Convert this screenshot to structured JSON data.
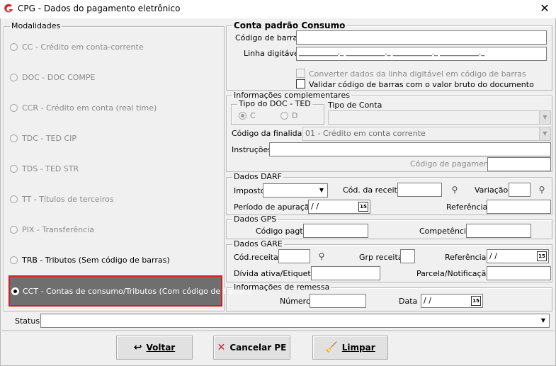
{
  "window": {
    "title": "CPG - Dados do pagamento eletrônico",
    "close_glyph": "✕",
    "logo_icon": "app-logo-icon"
  },
  "modalidades": {
    "legend": "Modalidades",
    "items": [
      {
        "label": "CC - Crédito em conta-corrente",
        "enabled": false,
        "selected": false
      },
      {
        "label": "DOC - DOC COMPE",
        "enabled": false,
        "selected": false
      },
      {
        "label": "CCR - Crédito em conta (real time)",
        "enabled": false,
        "selected": false
      },
      {
        "label": "TDC - TED CIP",
        "enabled": false,
        "selected": false
      },
      {
        "label": "TDS - TED STR",
        "enabled": false,
        "selected": false
      },
      {
        "label": "TT - Títulos de terceiros",
        "enabled": false,
        "selected": false
      },
      {
        "label": "PIX - Transferência",
        "enabled": false,
        "selected": false
      },
      {
        "label": "TRB - Tributos (Sem código de barras)",
        "enabled": true,
        "selected": false
      },
      {
        "label": "CCT - Contas de consumo/Tributos (Com código de barras)",
        "enabled": true,
        "selected": true
      }
    ]
  },
  "conta_padrao": {
    "legend": "Conta padrão Consumo",
    "codigo_barras_label": "Código de barras",
    "codigo_barras_value": "",
    "linha_digitavel_label": "Linha digitável",
    "linha_digitavel_value": "___________._ ___________._ ___________._ ___________._",
    "converter_label": "Converter dados da linha digitável em código de barras",
    "converter_checked": false,
    "validar_label": "Validar código de barras com o valor bruto do documento",
    "validar_checked": false
  },
  "info_complementares": {
    "legend": "Informações complementares",
    "tipo_doc_legend": "Tipo do DOC - TED",
    "option_c": "C",
    "option_d": "D",
    "tipo_conta_label": "Tipo de Conta",
    "tipo_conta_value": "",
    "codigo_finalidade_label": "Código da finalidade",
    "codigo_finalidade_value": "01 - Crédito em conta corrente",
    "instrucoes_label": "Instruções",
    "instrucoes_value": "",
    "codigo_pagamento_label": "Código de pagamento",
    "codigo_pagamento_value": ""
  },
  "darf": {
    "legend": "Dados DARF",
    "imposto_label": "Imposto",
    "imposto_value": "",
    "cod_receita_label": "Cód. da receita",
    "cod_receita_value": "",
    "variacao_label": "Variação",
    "variacao_value": "",
    "periodo_label": "Período de apuração",
    "periodo_value": " / /",
    "referencia_label": "Referência",
    "referencia_value": ""
  },
  "gps": {
    "legend": "Dados GPS",
    "codigo_pagto_label": "Código pagto",
    "codigo_pagto_value": "",
    "competencia_label": "Competência",
    "competencia_value": ""
  },
  "gare": {
    "legend": "Dados GARE",
    "cod_receita_label": "Cód.receita",
    "cod_receita_value": "",
    "grp_receita_label": "Grp receita",
    "grp_receita_value": "",
    "referencia_label": "Referência",
    "referencia_value": " / /",
    "divida_label": "Dívida ativa/Etiqueta",
    "divida_value": "",
    "parcela_label": "Parcela/Notificação",
    "parcela_value": ""
  },
  "remessa": {
    "legend": "Informações de remessa",
    "numero_label": "Número",
    "numero_value": "",
    "data_label": "Data",
    "data_value": " / /"
  },
  "status": {
    "label": "Status",
    "value": ""
  },
  "buttons": {
    "voltar": "Voltar",
    "cancelar": "Cancelar PE",
    "limpar": "Limpar"
  },
  "colors": {
    "selection_border": "#d22020",
    "selection_bg": "#6f6f6f",
    "logo_red": "#d42a2a"
  }
}
